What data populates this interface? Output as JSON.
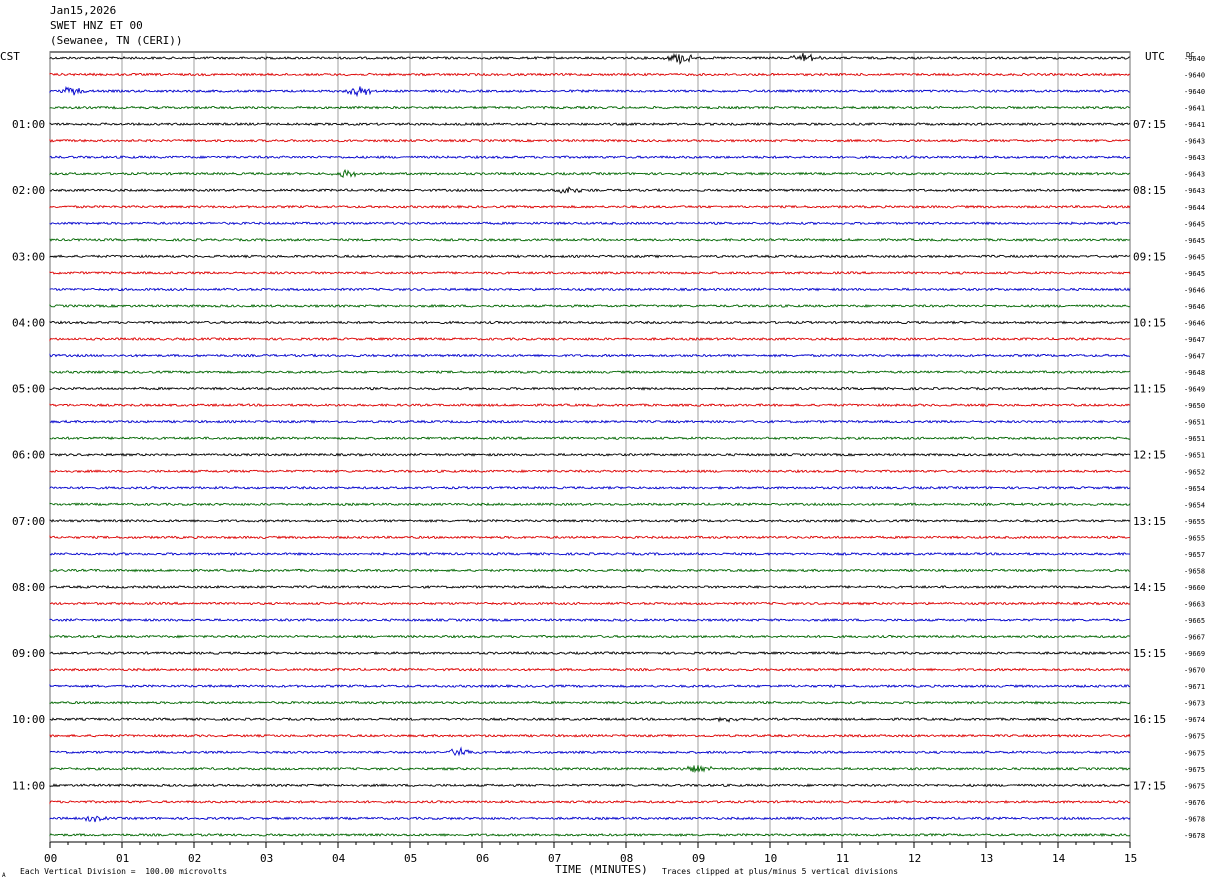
{
  "header": {
    "date": "Jan15,2026",
    "station": "SWET HNZ ET 00",
    "location": "(Sewanee, TN (CERI))"
  },
  "axes": {
    "left_tz": "CST",
    "right_tz": "UTC",
    "dc_label": "DC",
    "xlabel": "TIME (MINUTES)"
  },
  "footer": {
    "scale_note": "Each Vertical Division =  100.00 microvolts",
    "clip_note": "Traces clipped at plus/minus 5 vertical divisions",
    "corner_mark": "A"
  },
  "chart_data": {
    "type": "line",
    "description_type": "helicorder",
    "x": {
      "range": [
        0,
        15
      ],
      "ticks": [
        "00",
        "01",
        "02",
        "03",
        "04",
        "05",
        "06",
        "07",
        "08",
        "09",
        "10",
        "11",
        "12",
        "13",
        "14",
        "15"
      ]
    },
    "trace_colors": [
      "#000000",
      "#dd0000",
      "#0000cc",
      "#006600"
    ],
    "left_hour_labels": [
      "01:00",
      "02:00",
      "03:00",
      "04:00",
      "05:00",
      "06:00",
      "07:00",
      "08:00",
      "09:00",
      "10:00",
      "11:00"
    ],
    "right_hour_labels": [
      "07:15",
      "08:15",
      "09:15",
      "10:15",
      "11:15",
      "12:15",
      "13:15",
      "14:15",
      "15:15",
      "16:15",
      "17:15"
    ],
    "dc_offsets": [
      "-9640",
      "-9640",
      "-9640",
      "-9641",
      "-9641",
      "-9643",
      "-9643",
      "-9643",
      "-9643",
      "-9644",
      "-9645",
      "-9645",
      "-9645",
      "-9645",
      "-9646",
      "-9646",
      "-9646",
      "-9647",
      "-9647",
      "-9648",
      "-9649",
      "-9650",
      "-9651",
      "-9651",
      "-9651",
      "-9652",
      "-9654",
      "-9654",
      "-9655",
      "-9655",
      "-9657",
      "-9658",
      "-9660",
      "-9663",
      "-9665",
      "-9667",
      "-9669",
      "-9670",
      "-9671",
      "-9673",
      "-9674",
      "-9675",
      "-9675",
      "-9675",
      "-9675",
      "-9676",
      "-9678",
      "-9678"
    ],
    "events": [
      {
        "row": 0,
        "minute": 8.75,
        "amp": 6
      },
      {
        "row": 0,
        "minute": 10.5,
        "amp": 5
      },
      {
        "row": 2,
        "minute": 0.3,
        "amp": 4
      },
      {
        "row": 2,
        "minute": 4.3,
        "amp": 5
      },
      {
        "row": 7,
        "minute": 4.1,
        "amp": 4
      },
      {
        "row": 8,
        "minute": 7.2,
        "amp": 4
      },
      {
        "row": 42,
        "minute": 5.7,
        "amp": 5
      },
      {
        "row": 40,
        "minute": 9.4,
        "amp": 3
      },
      {
        "row": 43,
        "minute": 9.0,
        "amp": 4
      },
      {
        "row": 46,
        "minute": 0.6,
        "amp": 3
      }
    ]
  }
}
